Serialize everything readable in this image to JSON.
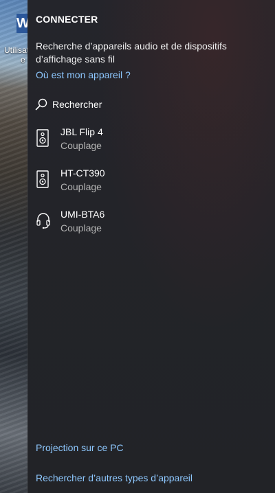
{
  "desktop": {
    "icon_letter": "W",
    "icon_label": "Utilisat",
    "icon_label_line2": "e"
  },
  "panel": {
    "title": "CONNECTER",
    "description": "Recherche d’appareils audio et de dispositifs d’affichage sans fil",
    "where_link": "Où est mon appareil ?",
    "search_label": "Rechercher",
    "devices": [
      {
        "name": "JBL Flip 4",
        "status": "Couplage",
        "icon": "speaker-icon"
      },
      {
        "name": "HT-CT390",
        "status": "Couplage",
        "icon": "speaker-icon"
      },
      {
        "name": "UMI-BTA6",
        "status": "Couplage",
        "icon": "headset-icon"
      }
    ],
    "projection_link": "Projection sur ce PC",
    "other_devices_link": "Rechercher d’autres types d’appareil"
  },
  "colors": {
    "link": "#8ec8ff",
    "panel_bg": "#232429",
    "secondary_text": "#b3b3b3"
  }
}
